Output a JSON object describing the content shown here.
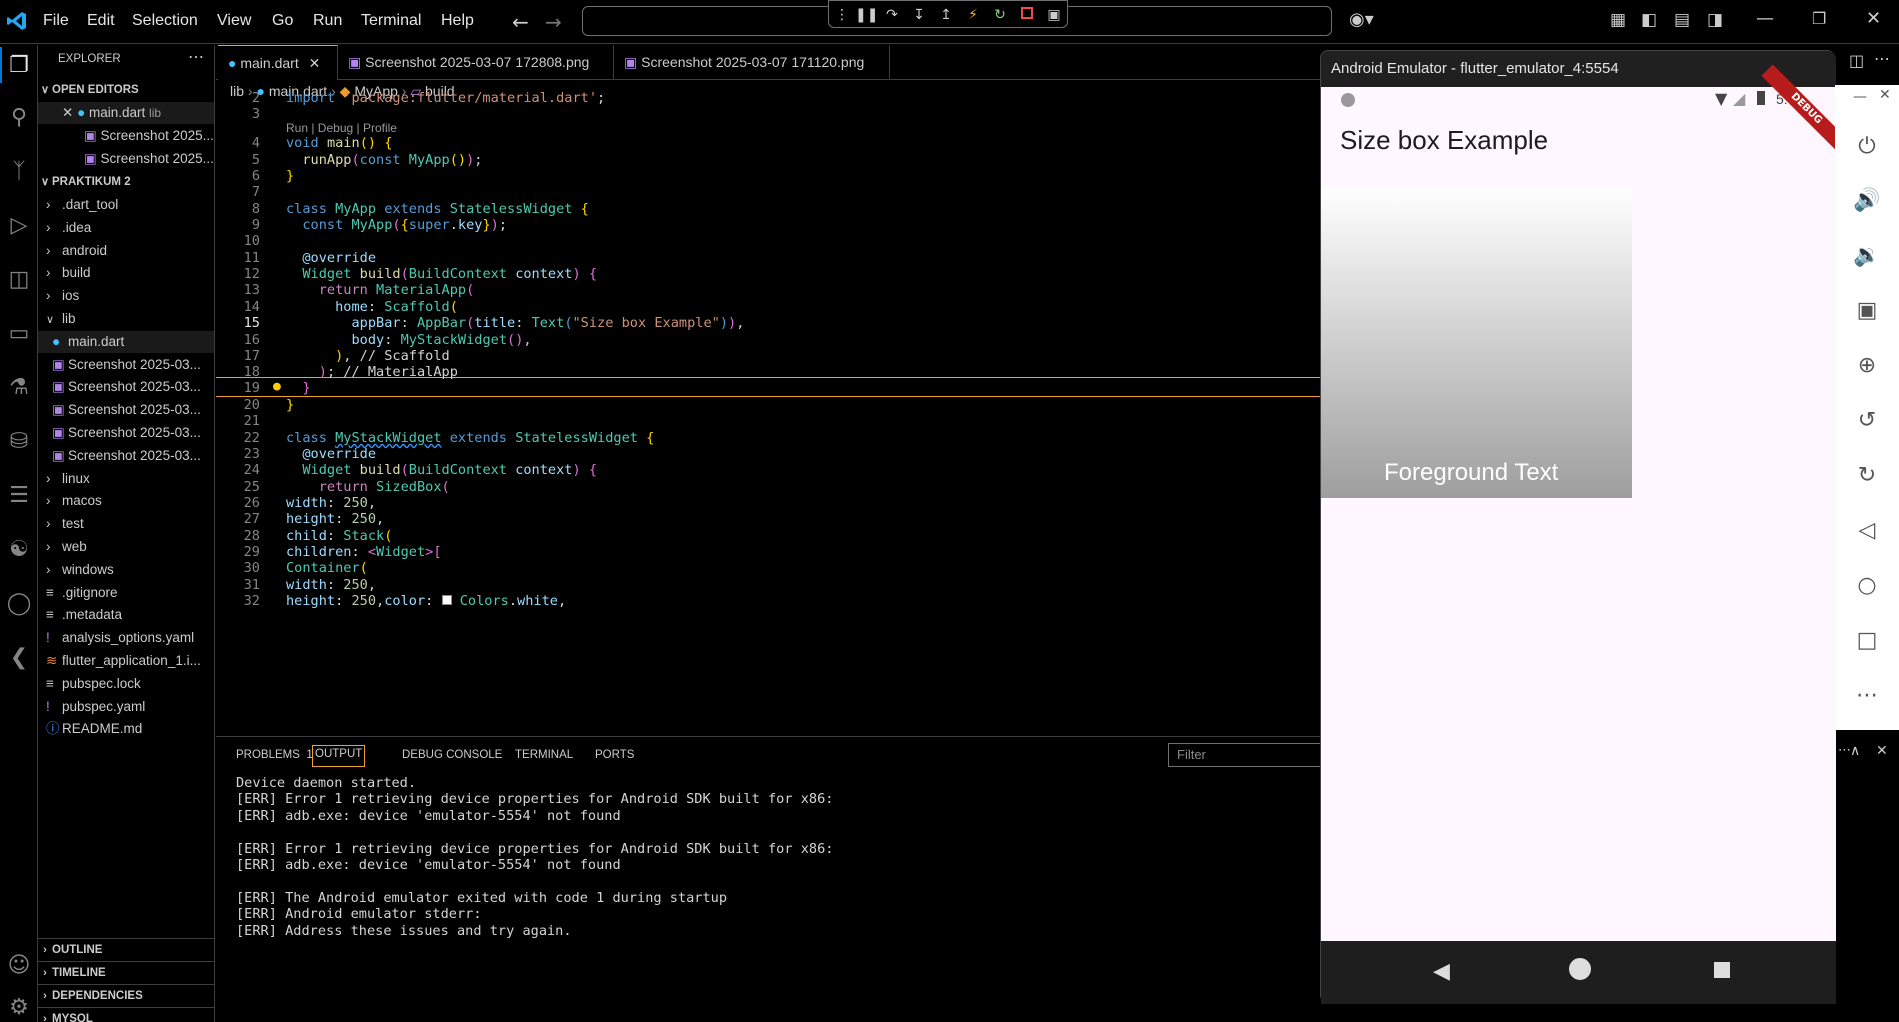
{
  "menu": [
    "File",
    "Edit",
    "Selection",
    "View",
    "Go",
    "Run",
    "Terminal",
    "Help"
  ],
  "sidebar": {
    "title": "EXPLORER",
    "open_editors_label": "OPEN EDITORS",
    "open_editors": [
      {
        "name": "main.dart",
        "hint": "lib"
      },
      {
        "name": "Screenshot 2025..."
      },
      {
        "name": "Screenshot 2025..."
      }
    ],
    "project_label": "PRAKTIKUM 2",
    "tree": [
      {
        "name": ".dart_tool",
        "type": "folder"
      },
      {
        "name": ".idea",
        "type": "folder"
      },
      {
        "name": "android",
        "type": "folder"
      },
      {
        "name": "build",
        "type": "folder"
      },
      {
        "name": "ios",
        "type": "folder"
      },
      {
        "name": "lib",
        "type": "folder-open"
      },
      {
        "name": "main.dart",
        "type": "file",
        "indent": true
      },
      {
        "name": "Screenshot 2025-03...",
        "type": "image",
        "indent": true
      },
      {
        "name": "Screenshot 2025-03...",
        "type": "image",
        "indent": true
      },
      {
        "name": "Screenshot 2025-03...",
        "type": "image",
        "indent": true
      },
      {
        "name": "Screenshot 2025-03...",
        "type": "image",
        "indent": true
      },
      {
        "name": "Screenshot 2025-03...",
        "type": "image",
        "indent": true
      },
      {
        "name": "linux",
        "type": "folder"
      },
      {
        "name": "macos",
        "type": "folder"
      },
      {
        "name": "test",
        "type": "folder"
      },
      {
        "name": "web",
        "type": "folder"
      },
      {
        "name": "windows",
        "type": "folder"
      },
      {
        "name": ".gitignore",
        "type": "file"
      },
      {
        "name": ".metadata",
        "type": "file"
      },
      {
        "name": "analysis_options.yaml",
        "type": "file"
      },
      {
        "name": "flutter_application_1.i...",
        "type": "file"
      },
      {
        "name": "pubspec.lock",
        "type": "file"
      },
      {
        "name": "pubspec.yaml",
        "type": "file"
      },
      {
        "name": "README.md",
        "type": "file"
      }
    ],
    "bottom_sections": [
      "OUTLINE",
      "TIMELINE",
      "DEPENDENCIES",
      "MYSQL"
    ]
  },
  "tabs": [
    {
      "label": "main.dart",
      "active": true
    },
    {
      "label": "Screenshot 2025-03-07 172808.png"
    },
    {
      "label": "Screenshot 2025-03-07 171120.png"
    }
  ],
  "breadcrumb": [
    "lib",
    "main.dart",
    "MyApp",
    "build"
  ],
  "codelens": "Run | Debug | Profile",
  "line_numbers": [
    "2",
    "3",
    "4",
    "5",
    "6",
    "7",
    "8",
    "9",
    "10",
    "11",
    "12",
    "13",
    "14",
    "15",
    "16",
    "17",
    "18",
    "19",
    "20",
    "21",
    "22",
    "23",
    "24",
    "25",
    "26",
    "27",
    "28",
    "29",
    "30",
    "31",
    "32"
  ],
  "panel": {
    "tabs": [
      {
        "label": "PROBLEMS",
        "badge": "1"
      },
      {
        "label": "OUTPUT",
        "active": true
      },
      {
        "label": "DEBUG CONSOLE"
      },
      {
        "label": "TERMINAL"
      },
      {
        "label": "PORTS"
      }
    ],
    "filter_placeholder": "Filter",
    "output_lines": [
      "Device daemon started.",
      "[ERR] Error 1 retrieving device properties for Android SDK built for x86:",
      "[ERR] adb.exe: device 'emulator-5554' not found",
      "",
      "[ERR] Error 1 retrieving device properties for Android SDK built for x86:",
      "[ERR] adb.exe: device 'emulator-5554' not found",
      "",
      "[ERR] The Android emulator exited with code 1 during startup",
      "[ERR] Android emulator stderr:",
      "[ERR] Address these issues and try again."
    ]
  },
  "emulator": {
    "title": "Android Emulator - flutter_emulator_4:5554",
    "app_bar_title": "Size box Example",
    "foreground_text": "Foreground Text",
    "debug_banner": "DEBUG",
    "status_time": "5:36"
  }
}
